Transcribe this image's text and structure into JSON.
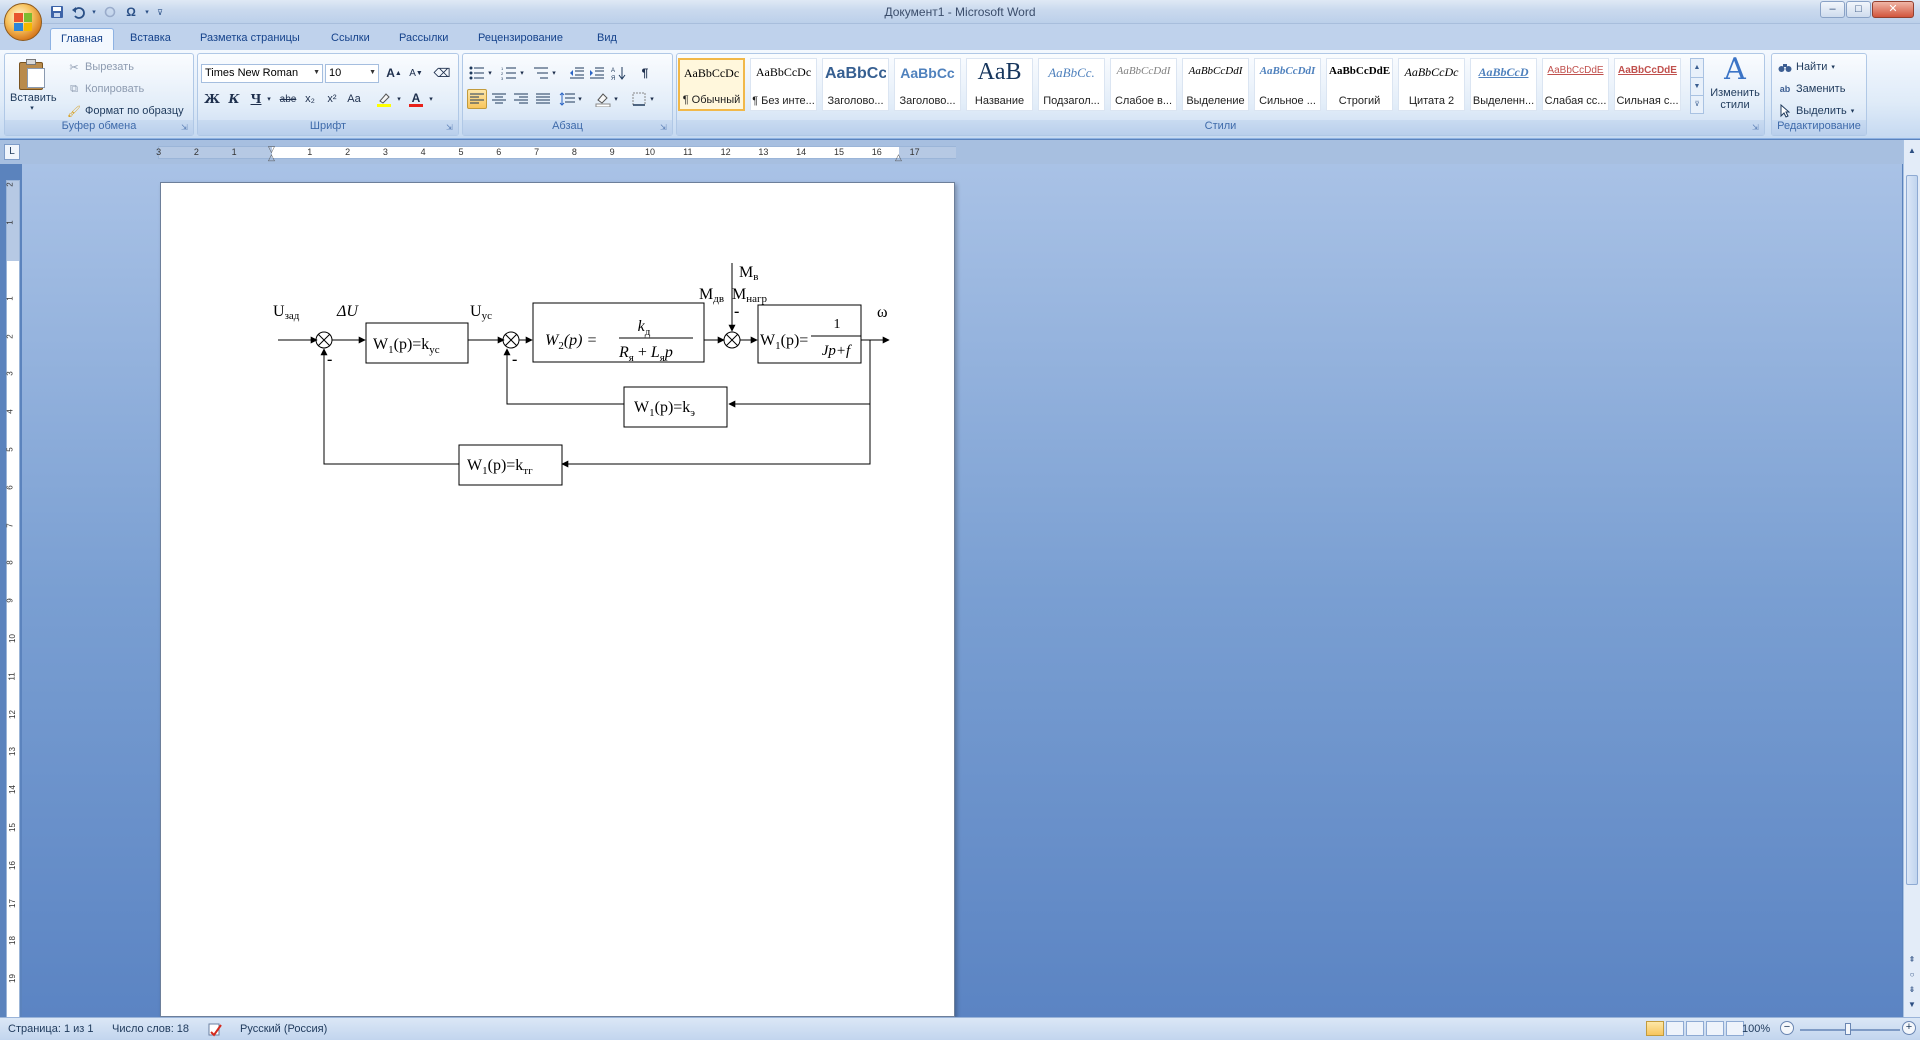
{
  "window": {
    "title": "Документ1 - Microsoft Word",
    "controls": {
      "minimize": "–",
      "maximize": "□",
      "close": "✕"
    }
  },
  "quick_access": {
    "save_icon": "save-icon",
    "undo_icon": "undo-icon",
    "redo_icon": "redo-icon",
    "symbol": "Ω"
  },
  "tabs": [
    "Главная",
    "Вставка",
    "Разметка страницы",
    "Ссылки",
    "Рассылки",
    "Рецензирование",
    "Вид"
  ],
  "ribbon": {
    "clipboard": {
      "label": "Буфер обмена",
      "paste": "Вставить",
      "cut": "Вырезать",
      "copy": "Копировать",
      "format_painter": "Формат по образцу"
    },
    "font": {
      "label": "Шрифт",
      "font_name": "Times New Roman",
      "font_size": "10",
      "grow": "A",
      "shrink": "A",
      "bold": "Ж",
      "italic": "К",
      "underline": "Ч",
      "strike": "abe",
      "subscript": "x₂",
      "superscript": "x²",
      "change_case": "Aa",
      "font_color": "A"
    },
    "paragraph": {
      "label": "Абзац",
      "pilcrow": "¶"
    },
    "styles": {
      "label": "Стили",
      "items": [
        {
          "sample": "AaBbCcDc",
          "name": "¶ Обычный"
        },
        {
          "sample": "AaBbCcDc",
          "name": "¶ Без инте..."
        },
        {
          "sample": "AaBbCc",
          "name": "Заголово..."
        },
        {
          "sample": "AaBbCc",
          "name": "Заголово..."
        },
        {
          "sample": "AaB",
          "name": "Название"
        },
        {
          "sample": "AaBbCc.",
          "name": "Подзагол..."
        },
        {
          "sample": "AaBbCcDdI",
          "name": "Слабое в..."
        },
        {
          "sample": "AaBbCcDdI",
          "name": "Выделение"
        },
        {
          "sample": "AaBbCcDdI",
          "name": "Сильное ..."
        },
        {
          "sample": "AaBbCcDdE",
          "name": "Строгий"
        },
        {
          "sample": "AaBbCcDc",
          "name": "Цитата 2"
        },
        {
          "sample": "AaBbCcD",
          "name": "Выделенн..."
        },
        {
          "sample": "AaBbCcDdE",
          "name": "Слабая сс..."
        },
        {
          "sample": "AaBbCcDdE",
          "name": "Сильная с..."
        }
      ],
      "change_styles": "Изменить стили"
    },
    "editing": {
      "label": "Редактирование",
      "find": "Найти",
      "replace": "Заменить",
      "select": "Выделить"
    }
  },
  "ruler": {
    "ticks": [
      "3",
      "2",
      "1",
      "1",
      "2",
      "3",
      "4",
      "5",
      "6",
      "7",
      "8",
      "9",
      "10",
      "11",
      "12",
      "13",
      "14",
      "15",
      "16",
      "17"
    ],
    "vticks": [
      "2",
      "1",
      "1",
      "2",
      "3",
      "4",
      "5",
      "6",
      "7",
      "8",
      "9",
      "10",
      "11",
      "12",
      "13",
      "14",
      "15",
      "16",
      "17",
      "18",
      "19",
      "20"
    ]
  },
  "diagram": {
    "u_ref": "U",
    "u_ref_sub": "зад",
    "delta_u": "ΔU",
    "u_amp": "U",
    "u_amp_sub": "ус",
    "block_amp": "W",
    "block_amp_sub1": "1",
    "block_amp_mid": "(p)=k",
    "block_amp_sub2": "ус",
    "block_motor_w": "W",
    "block_motor_sub": "2",
    "block_motor_p": "(p) =",
    "block_motor_num": "k",
    "block_motor_num_sub": "д",
    "block_motor_den_r": "R",
    "block_motor_den_r_sub": "я",
    "block_motor_den_plus": " + ",
    "block_motor_den_l": "L",
    "block_motor_den_l_sub": "я",
    "block_motor_den_p": "p",
    "m_load": "М",
    "m_load_sub": "в",
    "m_dv": "М",
    "m_dv_sub": "дв",
    "m_nagr": "М",
    "m_nagr_sub": "нагр",
    "block_mech_w": "W",
    "block_mech_sub": "1",
    "block_mech_p": "(p)=",
    "block_mech_num": "1",
    "block_mech_den": "Jp+f",
    "omega": "ω",
    "minus1": "-",
    "minus2": "-",
    "minus3": "-",
    "block_emf": "W",
    "block_emf_sub1": "1",
    "block_emf_mid": "(p)=k",
    "block_emf_sub2": "э",
    "block_tg": "W",
    "block_tg_sub1": "1",
    "block_tg_mid": "(p)=k",
    "block_tg_sub2": "тг"
  },
  "status": {
    "page": "Страница: 1 из 1",
    "words": "Число слов: 18",
    "language": "Русский (Россия)",
    "zoom": "100%"
  }
}
